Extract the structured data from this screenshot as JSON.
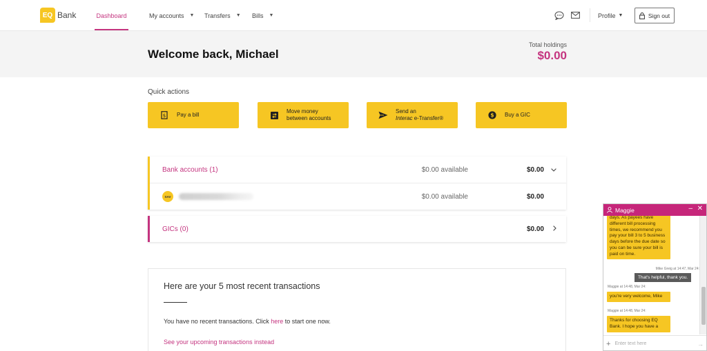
{
  "header": {
    "logo_mark": "EQ",
    "logo_text": "Bank",
    "nav": {
      "dashboard": "Dashboard",
      "my_accounts": "My accounts",
      "transfers": "Transfers",
      "bills": "Bills"
    },
    "profile": "Profile",
    "sign_out": "Sign out"
  },
  "welcome": {
    "title": "Welcome back, Michael",
    "holdings_label": "Total holdings",
    "holdings_value": "$0.00"
  },
  "quick_actions": {
    "title": "Quick actions",
    "pay_bill": "Pay a bill",
    "move_money_1": "Move money",
    "move_money_2": "between accounts",
    "send_1": "Send an",
    "send_interac": "Interac",
    "send_2": " e-Transfer®",
    "buy_gic": "Buy a GIC"
  },
  "accounts": {
    "bank": {
      "label": "Bank accounts (1)",
      "available": "$0.00 available",
      "amount": "$0.00"
    },
    "account_row": {
      "badge": "SAV",
      "available": "$0.00 available",
      "amount": "$0.00"
    },
    "gic": {
      "label": "GICs (0)",
      "amount": "$0.00"
    }
  },
  "transactions": {
    "title": "Here are your 5 most recent transactions",
    "empty_prefix": "You have no recent transactions. Click ",
    "empty_link": "here",
    "empty_suffix": " to start one now.",
    "upcoming_link": "See your upcoming transactions instead"
  },
  "chat": {
    "agent_name": "Maggie",
    "minimize": "–",
    "close": "✕",
    "messages": {
      "agent_1": "days. As payees have different bill processing times, we recommend you pay your bill 3 to 5 business days before the due date so you can be sure your bill is paid on time.",
      "user_meta": "Mike Greig at 14:47, Mar 24:",
      "user_1": "That's helpful, thank you.",
      "agent_meta_1": "Maggie at 14:48, Mar 24:",
      "agent_2": "you're very welcome, Mike",
      "agent_meta_2": "Maggie at 14:48, Mar 24:",
      "agent_3": "Thanks for choosing EQ Bank. I hope you have a"
    },
    "input_placeholder": "Enter text here"
  },
  "colors": {
    "brand_magenta": "#c4347f",
    "brand_yellow": "#f6c623"
  }
}
